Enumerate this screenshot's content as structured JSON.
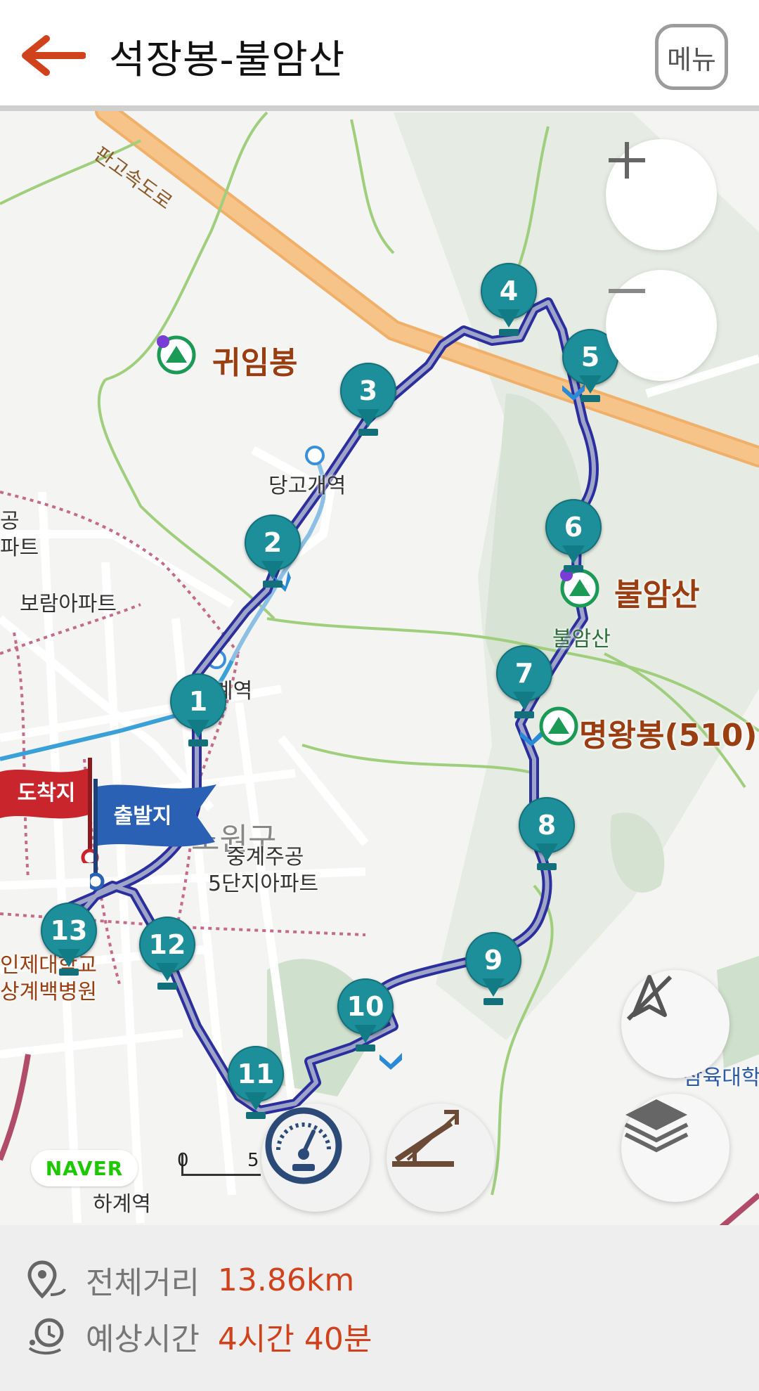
{
  "header": {
    "title": "석장봉-불암산",
    "menu_label": "메뉴",
    "back_icon": "arrow-left-icon",
    "accent_color": "#d0421b"
  },
  "map": {
    "labels": {
      "highway": "판고속도로",
      "peak_guimbong": "귀임봉",
      "peak_buramsan": "불암산",
      "peak_buramsan_small": "불암산",
      "peak_myeongwangbong": "명왕봉(510)",
      "station_danggogae": "당고개역",
      "apt_boram": "보람아파트",
      "apt_left_1": "공",
      "apt_left_2": "파트",
      "station_sanggye": "계역",
      "area_nowon": "노원구",
      "apt_junggye_1": "중계주공",
      "apt_junggye_2": "5단지아파트",
      "hospital_1": "인제대학교",
      "hospital_2": "상계백병원",
      "station_hagye": "하계역",
      "univ_right": "삼육대학",
      "scale_0": "0",
      "scale_5": "5"
    },
    "flags": {
      "end": "도착지",
      "start": "출발지"
    },
    "waypoints": [
      "1",
      "2",
      "3",
      "4",
      "5",
      "6",
      "7",
      "8",
      "9",
      "10",
      "11",
      "12",
      "13"
    ],
    "naver_logo": "NAVER",
    "controls": {
      "zoom_in_icon": "plus-icon",
      "zoom_out_icon": "minus-icon",
      "compass_icon": "compass-off-icon",
      "layers_icon": "layers-icon",
      "speed_icon": "speedometer-icon",
      "elevation_icon": "elevation-profile-icon"
    }
  },
  "info": {
    "distance_label": "전체거리",
    "distance_value": "13.86km",
    "time_label": "예상시간",
    "time_value": "4시간 40분",
    "distance_icon": "location-route-icon",
    "time_icon": "clock-route-icon"
  }
}
